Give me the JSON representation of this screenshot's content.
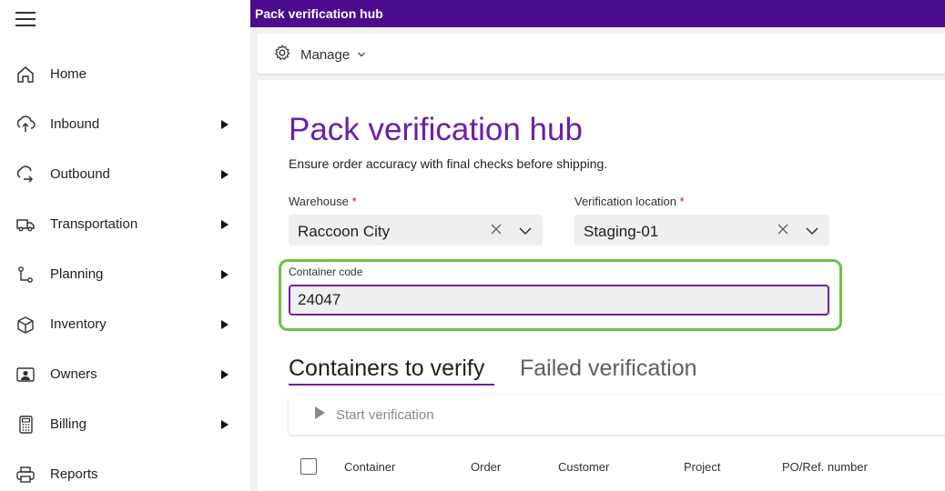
{
  "app": {
    "title": "Pack verification hub"
  },
  "sidebar": {
    "menu_icon": "hamburger-icon",
    "items": [
      {
        "label": "Home",
        "icon": "home-icon",
        "expandable": false
      },
      {
        "label": "Inbound",
        "icon": "inbound-icon",
        "expandable": true
      },
      {
        "label": "Outbound",
        "icon": "outbound-icon",
        "expandable": true
      },
      {
        "label": "Transportation",
        "icon": "truck-icon",
        "expandable": true
      },
      {
        "label": "Planning",
        "icon": "planning-icon",
        "expandable": true
      },
      {
        "label": "Inventory",
        "icon": "box-icon",
        "expandable": true
      },
      {
        "label": "Owners",
        "icon": "owner-icon",
        "expandable": true
      },
      {
        "label": "Billing",
        "icon": "calculator-icon",
        "expandable": true
      },
      {
        "label": "Reports",
        "icon": "printer-icon",
        "expandable": false
      }
    ]
  },
  "toolbar": {
    "manage_label": "Manage",
    "manage_icon": "gear-icon"
  },
  "page": {
    "title": "Pack verification hub",
    "subtitle": "Ensure order accuracy with final checks before shipping."
  },
  "form": {
    "warehouse": {
      "label": "Warehouse",
      "required_mark": "*",
      "value": "Raccoon City"
    },
    "location": {
      "label": "Verification location",
      "required_mark": "*",
      "value": "Staging-01"
    },
    "container_code": {
      "label": "Container code",
      "value": "24047"
    }
  },
  "tabs": [
    {
      "label": "Containers to verify",
      "active": true
    },
    {
      "label": "Failed verification",
      "active": false
    }
  ],
  "grid": {
    "start_label": "Start verification",
    "start_icon": "play-icon",
    "columns": [
      "Container",
      "Order",
      "Customer",
      "Project",
      "PO/Ref. number"
    ]
  },
  "colors": {
    "header_bg": "#4b0b8e",
    "accent": "#6b1fa8",
    "highlight": "#6cc04a",
    "required": "#c50f1f"
  }
}
